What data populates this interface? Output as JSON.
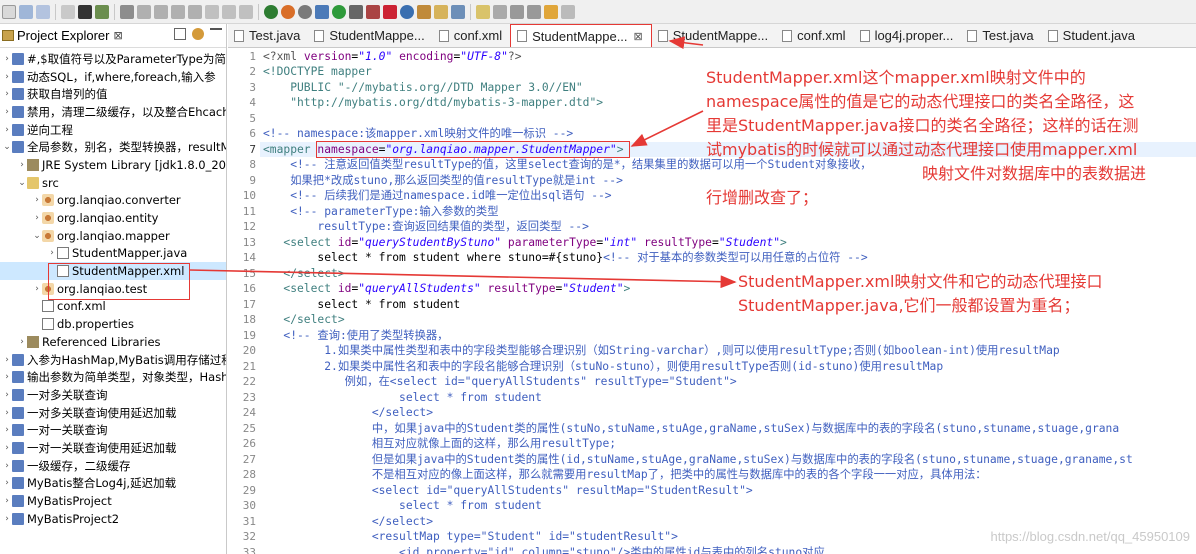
{
  "explorer": {
    "title": "Project Explorer",
    "close": "⊠",
    "items": [
      {
        "label": "#,$取值符号以及ParameterType为简",
        "arrow": "›",
        "icon": "proj",
        "indent": 0
      },
      {
        "label": "动态SQL，if,where,foreach,输入参",
        "arrow": "›",
        "icon": "proj",
        "indent": 0
      },
      {
        "label": "获取自增列的值",
        "arrow": "›",
        "icon": "proj",
        "indent": 0
      },
      {
        "label": "禁用，清理二级缓存，以及整合Ehcach",
        "arrow": "›",
        "icon": "proj",
        "indent": 0
      },
      {
        "label": "逆向工程",
        "arrow": "›",
        "icon": "proj",
        "indent": 0
      },
      {
        "label": "全局参数，别名，类型转换器，resultM",
        "arrow": "⌄",
        "icon": "proj",
        "indent": 0
      },
      {
        "label": "JRE System Library [jdk1.8.0_201]",
        "arrow": "›",
        "icon": "lib",
        "indent": 1
      },
      {
        "label": "src",
        "arrow": "⌄",
        "icon": "folder",
        "indent": 1
      },
      {
        "label": "org.lanqiao.converter",
        "arrow": "›",
        "icon": "pkg",
        "indent": 2
      },
      {
        "label": "org.lanqiao.entity",
        "arrow": "›",
        "icon": "pkg",
        "indent": 2
      },
      {
        "label": "org.lanqiao.mapper",
        "arrow": "⌄",
        "icon": "pkg",
        "indent": 2
      },
      {
        "label": "StudentMapper.java",
        "arrow": "›",
        "icon": "java",
        "indent": 3
      },
      {
        "label": "StudentMapper.xml",
        "arrow": "",
        "icon": "xml",
        "indent": 3,
        "selected": true
      },
      {
        "label": "org.lanqiao.test",
        "arrow": "›",
        "icon": "pkg",
        "indent": 2
      },
      {
        "label": "conf.xml",
        "arrow": "",
        "icon": "xml",
        "indent": 2
      },
      {
        "label": "db.properties",
        "arrow": "",
        "icon": "xml",
        "indent": 2
      },
      {
        "label": "Referenced Libraries",
        "arrow": "›",
        "icon": "lib",
        "indent": 1
      },
      {
        "label": "入参为HashMap,MyBatis调用存储过程",
        "arrow": "›",
        "icon": "proj",
        "indent": 0
      },
      {
        "label": "输出参数为简单类型，对象类型，Hash",
        "arrow": "›",
        "icon": "proj",
        "indent": 0
      },
      {
        "label": "一对多关联查询",
        "arrow": "›",
        "icon": "proj",
        "indent": 0
      },
      {
        "label": "一对多关联查询使用延迟加载",
        "arrow": "›",
        "icon": "proj",
        "indent": 0
      },
      {
        "label": "一对一关联查询",
        "arrow": "›",
        "icon": "proj",
        "indent": 0
      },
      {
        "label": "一对一关联查询使用延迟加载",
        "arrow": "›",
        "icon": "proj",
        "indent": 0
      },
      {
        "label": "一级缓存，二级缓存",
        "arrow": "›",
        "icon": "proj",
        "indent": 0
      },
      {
        "label": "MyBatis整合Log4j,延迟加载",
        "arrow": "›",
        "icon": "proj",
        "indent": 0
      },
      {
        "label": "MyBatisProject",
        "arrow": "›",
        "icon": "proj",
        "indent": 0
      },
      {
        "label": "MyBatisProject2",
        "arrow": "›",
        "icon": "proj",
        "indent": 0
      }
    ]
  },
  "tabs": [
    {
      "label": "Test.java",
      "active": false
    },
    {
      "label": "StudentMappe...",
      "active": false
    },
    {
      "label": "conf.xml",
      "active": false
    },
    {
      "label": "StudentMappe...",
      "active": true,
      "close": "⊠"
    },
    {
      "label": "StudentMappe...",
      "active": false
    },
    {
      "label": "conf.xml",
      "active": false
    },
    {
      "label": "log4j.proper...",
      "active": false
    },
    {
      "label": "Test.java",
      "active": false
    },
    {
      "label": "Student.java",
      "active": false
    }
  ],
  "editor": {
    "current_line": "7",
    "lines": [
      {
        "n": "1",
        "parts": [
          [
            "dec",
            "<?xml "
          ],
          [
            "att",
            "version"
          ],
          [
            "txt",
            "="
          ],
          [
            "str",
            "\"1.0\""
          ],
          [
            "txt",
            " "
          ],
          [
            "att",
            "encoding"
          ],
          [
            "txt",
            "="
          ],
          [
            "str",
            "\"UTF-8\""
          ],
          [
            "dec",
            "?>"
          ]
        ]
      },
      {
        "n": "2",
        "parts": [
          [
            "tag",
            "<!DOCTYPE mapper"
          ]
        ]
      },
      {
        "n": "3",
        "parts": [
          [
            "tag",
            "    PUBLIC \"-//mybatis.org//DTD Mapper 3.0//EN\""
          ]
        ]
      },
      {
        "n": "4",
        "parts": [
          [
            "tag",
            "    \"http://mybatis.org/dtd/mybatis-3-mapper.dtd\">"
          ]
        ]
      },
      {
        "n": "5",
        "parts": []
      },
      {
        "n": "6",
        "parts": [
          [
            "cmt",
            "<!-- namespace:该mapper.xml映射文件的唯一标识 -->"
          ]
        ]
      },
      {
        "n": "7",
        "parts": [
          [
            "tag",
            "<mapper "
          ],
          [
            "att",
            "namespace"
          ],
          [
            "txt",
            "="
          ],
          [
            "str",
            "\"org.lanqiao.mapper.StudentMapper\""
          ],
          [
            "tag",
            ">"
          ]
        ]
      },
      {
        "n": "8",
        "parts": [
          [
            "cmt",
            "    <!-- 注意返回值类型resultType的值，这里select查询的是*，结果集里的数据可以用一个Student对象接收，"
          ]
        ]
      },
      {
        "n": "9",
        "parts": [
          [
            "cmt",
            "    如果把*改成stuno,那么返回类型的值resultType就是int -->"
          ]
        ]
      },
      {
        "n": "10",
        "parts": [
          [
            "cmt",
            "    <!-- 后续我们是通过namespace.id唯一定位出sql语句 -->"
          ]
        ]
      },
      {
        "n": "11",
        "parts": [
          [
            "cmt",
            "    <!-- parameterType:输入参数的类型"
          ]
        ]
      },
      {
        "n": "12",
        "parts": [
          [
            "cmt",
            "        resultType:查询返回结果值的类型，返回类型 -->"
          ]
        ]
      },
      {
        "n": "13",
        "parts": [
          [
            "tag",
            "   <select "
          ],
          [
            "att",
            "id"
          ],
          [
            "txt",
            "="
          ],
          [
            "str",
            "\"queryStudentByStuno\""
          ],
          [
            "txt",
            " "
          ],
          [
            "att",
            "parameterType"
          ],
          [
            "txt",
            "="
          ],
          [
            "str",
            "\"int\""
          ],
          [
            "txt",
            " "
          ],
          [
            "att",
            "resultType"
          ],
          [
            "txt",
            "="
          ],
          [
            "str",
            "\"Student\""
          ],
          [
            "tag",
            ">"
          ]
        ]
      },
      {
        "n": "14",
        "parts": [
          [
            "txt",
            "        select * from student where stuno=#{stuno}"
          ],
          [
            "cmt",
            "<!-- 对于基本的参数类型可以用任意的占位符 -->"
          ]
        ]
      },
      {
        "n": "15",
        "parts": [
          [
            "tag",
            "   </select>"
          ]
        ]
      },
      {
        "n": "16",
        "parts": [
          [
            "tag",
            "   <select "
          ],
          [
            "att",
            "id"
          ],
          [
            "txt",
            "="
          ],
          [
            "str",
            "\"queryAllStudents\""
          ],
          [
            "txt",
            " "
          ],
          [
            "att",
            "resultType"
          ],
          [
            "txt",
            "="
          ],
          [
            "str",
            "\"Student\""
          ],
          [
            "tag",
            ">"
          ]
        ]
      },
      {
        "n": "17",
        "parts": [
          [
            "txt",
            "        select * from student"
          ]
        ]
      },
      {
        "n": "18",
        "parts": [
          [
            "tag",
            "   </select>"
          ]
        ]
      },
      {
        "n": "19",
        "parts": [
          [
            "cmt",
            "   <!-- 查询:使用了类型转换器，"
          ]
        ]
      },
      {
        "n": "20",
        "parts": [
          [
            "cmt",
            "         1.如果类中属性类型和表中的字段类型能够合理识别（如String-varchar）,则可以使用resultType;否则(如boolean-int)使用resultMap"
          ]
        ]
      },
      {
        "n": "21",
        "parts": [
          [
            "cmt",
            "         2.如果类中属性名和表中的字段名能够合理识别（stuNo-stuno），则使用resultType否则(id-stuno)使用resultMap"
          ]
        ]
      },
      {
        "n": "22",
        "parts": [
          [
            "cmt",
            "            例如，在<select id=\"queryAllStudents\" resultType=\"Student\">"
          ]
        ]
      },
      {
        "n": "23",
        "parts": [
          [
            "cmt",
            "                    select * from student"
          ]
        ]
      },
      {
        "n": "24",
        "parts": [
          [
            "cmt",
            "                </select>"
          ]
        ]
      },
      {
        "n": "25",
        "parts": [
          [
            "cmt",
            "                中，如果java中的Student类的属性(stuNo,stuName,stuAge,graName,stuSex)与数据库中的表的字段名(stuno,stuname,stuage,grana"
          ]
        ]
      },
      {
        "n": "26",
        "parts": [
          [
            "cmt",
            "                相互对应就像上面的这样，那么用resultType;"
          ]
        ]
      },
      {
        "n": "27",
        "parts": [
          [
            "cmt",
            "                但是如果java中的Student类的属性(id,stuName,stuAge,graName,stuSex)与数据库中的表的字段名(stuno,stuname,stuage,graname,st"
          ]
        ]
      },
      {
        "n": "28",
        "parts": [
          [
            "cmt",
            "                不是相互对应的像上面这样，那么就需要用resultMap了，把类中的属性与数据库中的表的各个字段一一对应，具体用法："
          ]
        ]
      },
      {
        "n": "29",
        "parts": [
          [
            "cmt",
            "                <select id=\"queryAllStudents\" resultMap=\"StudentResult\">"
          ]
        ]
      },
      {
        "n": "30",
        "parts": [
          [
            "cmt",
            "                    select * from student"
          ]
        ]
      },
      {
        "n": "31",
        "parts": [
          [
            "cmt",
            "                </select>"
          ]
        ]
      },
      {
        "n": "32",
        "parts": [
          [
            "cmt",
            "                <resultMap type=\"Student\" id=\"studentResult\">"
          ]
        ]
      },
      {
        "n": "33",
        "parts": [
          [
            "cmt",
            "                    <id property=\"id\" column=\"stuno\"/>类中的属性id与表中的列名stuno对应"
          ]
        ]
      }
    ]
  },
  "annotations": {
    "note1": [
      "StudentMapper.xml这个mapper.xml映射文件中的",
      "namespace属性的值是它的动态代理接口的类名全路径，这",
      "里是StudentMapper.java接口的类名全路径；这样的话在测",
      "试mybatis的时候就可以通过动态代理接口使用mapper.xml",
      "映射文件对数据库中的表数据进"
    ],
    "note1_last": "行增删改查了；",
    "note2": [
      "StudentMapper.xml映射文件和它的动态代理接口",
      "StudentMapper.java,它们一般都设置为重名；"
    ],
    "color": "#e53935"
  },
  "watermark": "https://blog.csdn.net/qq_45950109"
}
